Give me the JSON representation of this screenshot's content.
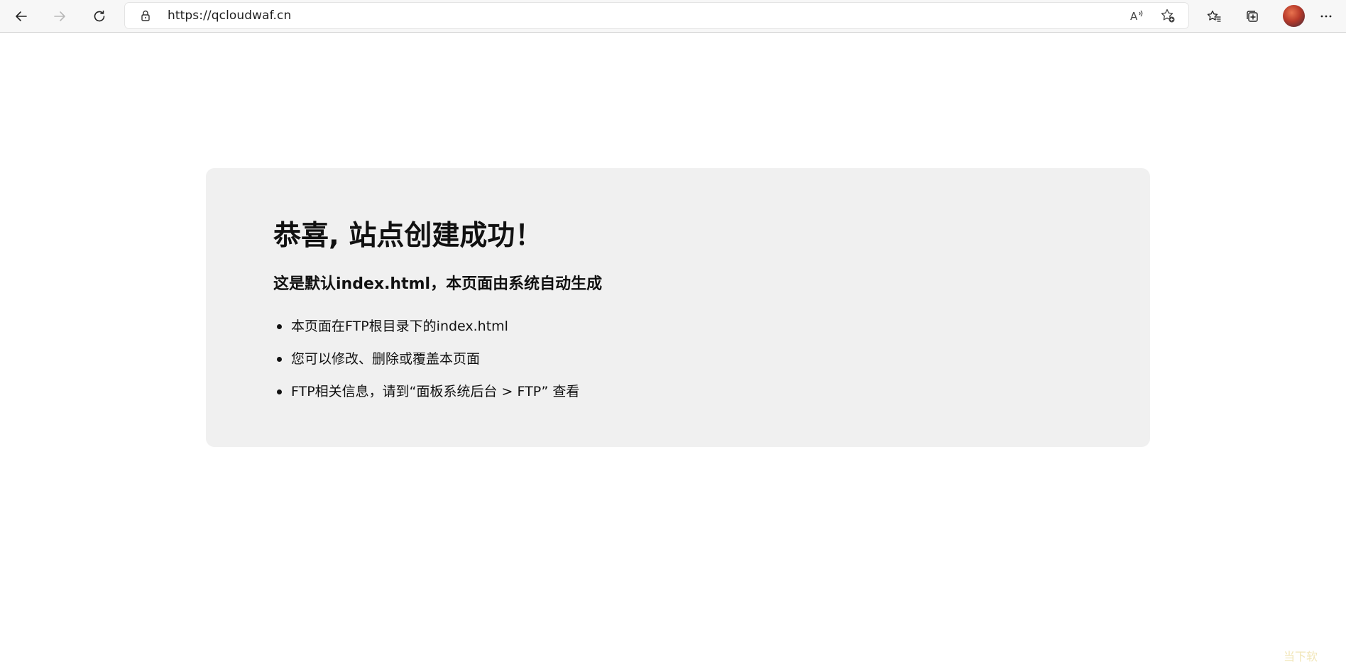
{
  "browser": {
    "url": "https://qcloudwaf.cn",
    "icons": {
      "back": "arrow-left-icon",
      "forward": "arrow-right-icon",
      "refresh": "refresh-icon",
      "lock": "lock-icon",
      "read_aloud": "read-aloud-icon",
      "add_favorite": "star-plus-icon",
      "favorites": "favorites-icon",
      "collections": "collections-icon",
      "profile": "avatar",
      "more": "more-icon"
    }
  },
  "card": {
    "title": "恭喜, 站点创建成功！",
    "subtitle": "这是默认index.html，本页面由系统自动生成",
    "items": [
      "本页面在FTP根目录下的index.html",
      "您可以修改、删除或覆盖本页面",
      "FTP相关信息，请到“面板系统后台 > FTP” 查看"
    ]
  },
  "watermark": {
    "text": "当下软"
  },
  "colors": {
    "card_background": "#f0f0f0",
    "toolbar_background": "#f7f7f7",
    "text": "#111111"
  }
}
